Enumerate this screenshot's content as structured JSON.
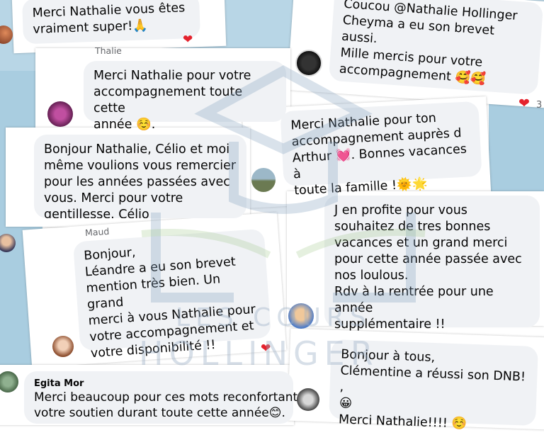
{
  "watermark": {
    "line1": "LES COURS",
    "line2": "HOLLINGER"
  },
  "comments": [
    {
      "id": "c1",
      "text": "Merci Nathalie vous êtes\nvraiment super!🙏"
    },
    {
      "id": "c2",
      "text": "Coucou @Nathalie Hollinger\nCheyma a eu son brevet aussi.\nMille mercis pour votre\naccompagnement 🥰🥰"
    },
    {
      "id": "c3",
      "author": "Thalie",
      "text": "Merci Nathalie pour votre\naccompagnement toute cette\nannée ☺️."
    },
    {
      "id": "c4",
      "text": "Merci Nathalie pour ton\naccompagnement auprès d\nArthur 💓. Bonnes vacances à\ntoute la famille !🌞🌟"
    },
    {
      "id": "c5",
      "text": "Bonjour Nathalie, Célio et moi\nmême voulions vous remercier\npour les années passées avec\nvous. Merci pour votre\ngentillesse. Célio"
    },
    {
      "id": "c6",
      "text": "J en profite pour vous\nsouhaitez de tres bonnes\nvacances et un grand merci\npour cette année passée avec\nnos loulous.\nRdv à la rentrée pour une année\nsupplémentaire !!"
    },
    {
      "id": "c7",
      "author": "Maud",
      "text": "Bonjour,\nLéandre a eu son brevet\nmention très bien. Un grand\nmerci à vous Nathalie pour\nvotre accompagnement et\nvotre disponibilité !!"
    },
    {
      "id": "c8",
      "author": "Egita Mor",
      "text": "Merci beaucoup pour ces mots reconfortants\nvotre soutien durant toute cette année😊."
    },
    {
      "id": "c9",
      "text": "Bonjour à tous,\nClémentine a réussi son DNB! ,\n😀\nMerci Nathalie!!!! ☺️"
    }
  ],
  "reactions": {
    "heart_symbol": "❤",
    "c2_count": "3"
  },
  "colors": {
    "bubble": "#f0f2f5",
    "heart": "#e4222d",
    "panel": "#a9cde0"
  }
}
